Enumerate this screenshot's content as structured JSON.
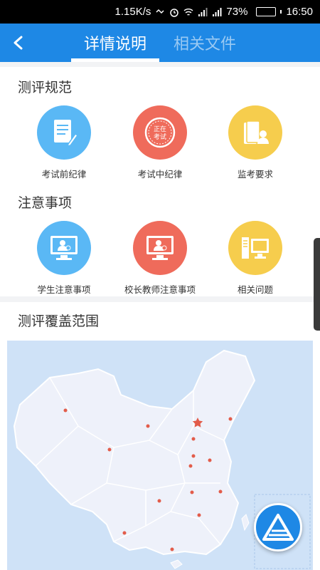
{
  "status_bar": {
    "speed": "1.15K/s",
    "battery": "73%",
    "battery_level": 0.73,
    "time": "16:50"
  },
  "nav": {
    "back_icon": "chevron-left-icon",
    "tabs": [
      {
        "label": "详情说明",
        "active": true
      },
      {
        "label": "相关文件",
        "active": false
      }
    ]
  },
  "section_rules": {
    "title": "测评规范",
    "items": [
      {
        "label": "考试前纪律",
        "icon": "exam-notes-icon",
        "color": "#5ab8f5"
      },
      {
        "label": "考试中纪律",
        "icon": "exam-stamp-icon",
        "stamp_text": "正在考试",
        "color": "#ef6b5b"
      },
      {
        "label": "监考要求",
        "icon": "proctor-book-icon",
        "color": "#f6cd4d"
      }
    ]
  },
  "section_notes": {
    "title": "注意事项",
    "items": [
      {
        "label": "学生注意事项",
        "icon": "student-monitor-icon",
        "color": "#5ab8f5"
      },
      {
        "label": "校长教师注意事项",
        "icon": "teacher-monitor-icon",
        "color": "#ef6b5b"
      },
      {
        "label": "相关问题",
        "icon": "computer-icon",
        "color": "#f6cd4d"
      }
    ]
  },
  "section_coverage": {
    "title": "测评覆盖范围"
  },
  "colors": {
    "primary": "#1e88e5",
    "map_water": "#cfe2f7",
    "map_land": "#eef1fa",
    "marker": "#e25c4a"
  }
}
